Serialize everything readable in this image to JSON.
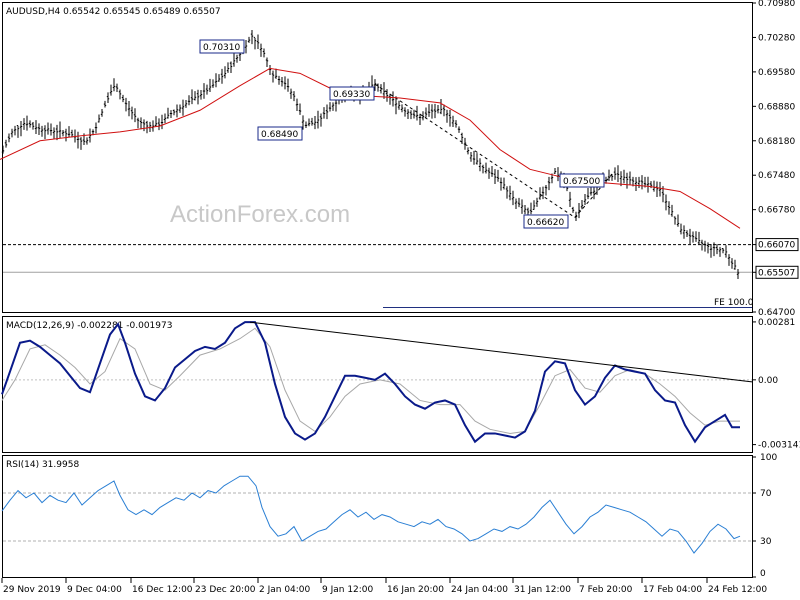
{
  "header": {
    "main": "AUDUSD,H4  0.65542 0.65545 0.65489 0.65507",
    "macd": "MACD(12,26,9) -0.002281 -0.001973",
    "rsi": "RSI(14) 31.9958"
  },
  "watermark": "ActionForex.com",
  "fe_label": "FE 100.0",
  "chart_data": [
    {
      "type": "line",
      "name": "price",
      "ylim": [
        0.647,
        0.7098
      ],
      "price_ticks": [
        "0.70980",
        "0.70280",
        "0.69580",
        "0.68880",
        "0.68180",
        "0.67480",
        "0.66780",
        "0.66070",
        "0.65507",
        "0.64700"
      ],
      "x_labels": [
        "29 Nov 2019",
        "9 Dec 04:00",
        "16 Dec 12:00",
        "23 Dec 20:00",
        "2 Jan 04:00",
        "9 Jan 12:00",
        "16 Jan 20:00",
        "24 Jan 04:00",
        "31 Jan 12:00",
        "7 Feb 20:00",
        "17 Feb 04:00",
        "24 Feb 12:00"
      ],
      "annotations": [
        "0.70310",
        "0.68490",
        "0.69330",
        "0.66620",
        "0.67500"
      ],
      "levels": [
        0.6607,
        0.65507
      ],
      "last_price": "0.65507",
      "close_path": [
        [
          0,
          0.6785
        ],
        [
          12,
          0.6835
        ],
        [
          25,
          0.6855
        ],
        [
          40,
          0.6842
        ],
        [
          55,
          0.6838
        ],
        [
          70,
          0.6832
        ],
        [
          85,
          0.6815
        ],
        [
          95,
          0.6842
        ],
        [
          105,
          0.689
        ],
        [
          115,
          0.6935
        ],
        [
          122,
          0.6905
        ],
        [
          130,
          0.688
        ],
        [
          140,
          0.6855
        ],
        [
          150,
          0.6848
        ],
        [
          160,
          0.6852
        ],
        [
          170,
          0.6872
        ],
        [
          180,
          0.6885
        ],
        [
          195,
          0.6905
        ],
        [
          210,
          0.6925
        ],
        [
          225,
          0.6955
        ],
        [
          240,
          0.6995
        ],
        [
          252,
          0.7031
        ],
        [
          262,
          0.7005
        ],
        [
          272,
          0.6955
        ],
        [
          285,
          0.6935
        ],
        [
          295,
          0.6905
        ],
        [
          305,
          0.6849
        ],
        [
          318,
          0.6858
        ],
        [
          330,
          0.6885
        ],
        [
          345,
          0.6915
        ],
        [
          360,
          0.6912
        ],
        [
          375,
          0.6933
        ],
        [
          390,
          0.6905
        ],
        [
          405,
          0.688
        ],
        [
          420,
          0.6865
        ],
        [
          432,
          0.6878
        ],
        [
          445,
          0.688
        ],
        [
          458,
          0.6845
        ],
        [
          470,
          0.679
        ],
        [
          485,
          0.676
        ],
        [
          500,
          0.6738
        ],
        [
          515,
          0.6695
        ],
        [
          530,
          0.667
        ],
        [
          545,
          0.672
        ],
        [
          555,
          0.6755
        ],
        [
          565,
          0.6735
        ],
        [
          575,
          0.6662
        ],
        [
          585,
          0.6698
        ],
        [
          600,
          0.673
        ],
        [
          615,
          0.675
        ],
        [
          630,
          0.674
        ],
        [
          645,
          0.673
        ],
        [
          660,
          0.672
        ],
        [
          670,
          0.668
        ],
        [
          680,
          0.664
        ],
        [
          695,
          0.6618
        ],
        [
          710,
          0.66
        ],
        [
          725,
          0.6595
        ],
        [
          738,
          0.6551
        ]
      ],
      "ma_path": [
        [
          0,
          0.678
        ],
        [
          40,
          0.6818
        ],
        [
          80,
          0.6828
        ],
        [
          120,
          0.6836
        ],
        [
          160,
          0.6848
        ],
        [
          200,
          0.688
        ],
        [
          240,
          0.693
        ],
        [
          270,
          0.6965
        ],
        [
          300,
          0.6955
        ],
        [
          330,
          0.6925
        ],
        [
          360,
          0.691
        ],
        [
          400,
          0.6905
        ],
        [
          440,
          0.6895
        ],
        [
          470,
          0.686
        ],
        [
          500,
          0.68
        ],
        [
          530,
          0.676
        ],
        [
          560,
          0.6745
        ],
        [
          590,
          0.6735
        ],
        [
          620,
          0.673
        ],
        [
          650,
          0.6725
        ],
        [
          680,
          0.6715
        ],
        [
          710,
          0.668
        ],
        [
          740,
          0.664
        ]
      ]
    },
    {
      "type": "line",
      "name": "MACD(12,26,9)",
      "ylim": [
        -0.0035,
        0.003
      ],
      "ticks": [
        "0.00281",
        "0.00",
        "-0.003141"
      ],
      "macd_path": [
        [
          2,
          -0.0007
        ],
        [
          10,
          0.0004
        ],
        [
          20,
          0.0018
        ],
        [
          30,
          0.0019
        ],
        [
          40,
          0.0016
        ],
        [
          50,
          0.0012
        ],
        [
          60,
          0.0008
        ],
        [
          70,
          0.0002
        ],
        [
          80,
          -0.0004
        ],
        [
          90,
          -0.0006
        ],
        [
          100,
          0.0008
        ],
        [
          110,
          0.0022
        ],
        [
          118,
          0.0027
        ],
        [
          125,
          0.0018
        ],
        [
          135,
          0.0003
        ],
        [
          145,
          -0.0008
        ],
        [
          155,
          -0.001
        ],
        [
          165,
          -0.0004
        ],
        [
          175,
          0.0006
        ],
        [
          185,
          0.001
        ],
        [
          195,
          0.0014
        ],
        [
          205,
          0.0016
        ],
        [
          215,
          0.0015
        ],
        [
          225,
          0.0018
        ],
        [
          235,
          0.0025
        ],
        [
          245,
          0.0028
        ],
        [
          255,
          0.0028
        ],
        [
          265,
          0.0018
        ],
        [
          275,
          -0.0002
        ],
        [
          285,
          -0.0018
        ],
        [
          295,
          -0.0026
        ],
        [
          305,
          -0.0029
        ],
        [
          315,
          -0.0026
        ],
        [
          325,
          -0.0018
        ],
        [
          335,
          -0.0008
        ],
        [
          345,
          0.0002
        ],
        [
          355,
          0.0002
        ],
        [
          365,
          0.0001
        ],
        [
          375,
          0.0
        ],
        [
          385,
          0.0003
        ],
        [
          395,
          -0.0002
        ],
        [
          405,
          -0.0008
        ],
        [
          415,
          -0.0012
        ],
        [
          425,
          -0.0014
        ],
        [
          435,
          -0.0011
        ],
        [
          445,
          -0.001
        ],
        [
          455,
          -0.0012
        ],
        [
          465,
          -0.0022
        ],
        [
          475,
          -0.003
        ],
        [
          485,
          -0.0026
        ],
        [
          495,
          -0.0026
        ],
        [
          505,
          -0.0027
        ],
        [
          515,
          -0.0028
        ],
        [
          525,
          -0.0025
        ],
        [
          535,
          -0.0015
        ],
        [
          545,
          0.0004
        ],
        [
          555,
          0.0009
        ],
        [
          565,
          0.0008
        ],
        [
          575,
          -0.0005
        ],
        [
          585,
          -0.0012
        ],
        [
          595,
          -0.0008
        ],
        [
          605,
          0.0001
        ],
        [
          615,
          0.0007
        ],
        [
          625,
          0.0005
        ],
        [
          635,
          0.0004
        ],
        [
          645,
          0.0003
        ],
        [
          655,
          -0.0005
        ],
        [
          665,
          -0.001
        ],
        [
          675,
          -0.0011
        ],
        [
          685,
          -0.0022
        ],
        [
          695,
          -0.003
        ],
        [
          705,
          -0.0023
        ],
        [
          715,
          -0.002
        ],
        [
          725,
          -0.0017
        ],
        [
          732,
          -0.0023
        ],
        [
          740,
          -0.0023
        ]
      ],
      "signal_path": [
        [
          2,
          -0.001
        ],
        [
          15,
          0.0
        ],
        [
          30,
          0.0015
        ],
        [
          45,
          0.0017
        ],
        [
          60,
          0.0012
        ],
        [
          75,
          0.0006
        ],
        [
          90,
          -0.0002
        ],
        [
          105,
          0.0004
        ],
        [
          120,
          0.002
        ],
        [
          135,
          0.0015
        ],
        [
          150,
          -0.0002
        ],
        [
          165,
          -0.0005
        ],
        [
          180,
          0.0002
        ],
        [
          200,
          0.0012
        ],
        [
          220,
          0.0015
        ],
        [
          240,
          0.002
        ],
        [
          255,
          0.0025
        ],
        [
          270,
          0.0016
        ],
        [
          285,
          -0.0005
        ],
        [
          300,
          -0.002
        ],
        [
          315,
          -0.0025
        ],
        [
          330,
          -0.0018
        ],
        [
          345,
          -0.0008
        ],
        [
          360,
          -0.0002
        ],
        [
          380,
          0.0
        ],
        [
          400,
          -0.0002
        ],
        [
          420,
          -0.001
        ],
        [
          440,
          -0.0012
        ],
        [
          460,
          -0.0012
        ],
        [
          475,
          -0.002
        ],
        [
          490,
          -0.0024
        ],
        [
          510,
          -0.0026
        ],
        [
          525,
          -0.0025
        ],
        [
          540,
          -0.0012
        ],
        [
          555,
          0.0002
        ],
        [
          570,
          0.0005
        ],
        [
          585,
          -0.0004
        ],
        [
          600,
          -0.0006
        ],
        [
          615,
          0.0002
        ],
        [
          630,
          0.0005
        ],
        [
          645,
          0.0003
        ],
        [
          660,
          -0.0002
        ],
        [
          675,
          -0.0008
        ],
        [
          690,
          -0.0016
        ],
        [
          705,
          -0.0022
        ],
        [
          720,
          -0.002
        ],
        [
          740,
          -0.002
        ]
      ],
      "trendline": [
        [
          250,
          0.0028
        ],
        [
          752,
          -0.0001
        ]
      ]
    },
    {
      "type": "line",
      "name": "RSI(14)",
      "ylim": [
        0,
        100
      ],
      "ticks": [
        "100",
        "70",
        "30",
        "0"
      ],
      "levels": [
        70,
        30
      ],
      "rsi_path": [
        [
          2,
          55
        ],
        [
          10,
          64
        ],
        [
          18,
          72
        ],
        [
          26,
          66
        ],
        [
          34,
          70
        ],
        [
          42,
          62
        ],
        [
          50,
          68
        ],
        [
          58,
          64
        ],
        [
          66,
          62
        ],
        [
          74,
          70
        ],
        [
          82,
          60
        ],
        [
          90,
          66
        ],
        [
          98,
          72
        ],
        [
          106,
          76
        ],
        [
          114,
          80
        ],
        [
          120,
          68
        ],
        [
          128,
          56
        ],
        [
          136,
          52
        ],
        [
          144,
          56
        ],
        [
          152,
          52
        ],
        [
          160,
          58
        ],
        [
          168,
          62
        ],
        [
          176,
          66
        ],
        [
          184,
          64
        ],
        [
          192,
          70
        ],
        [
          200,
          66
        ],
        [
          208,
          72
        ],
        [
          216,
          70
        ],
        [
          224,
          76
        ],
        [
          232,
          80
        ],
        [
          240,
          84
        ],
        [
          248,
          84
        ],
        [
          256,
          76
        ],
        [
          262,
          58
        ],
        [
          270,
          42
        ],
        [
          278,
          34
        ],
        [
          286,
          36
        ],
        [
          294,
          42
        ],
        [
          302,
          30
        ],
        [
          310,
          34
        ],
        [
          318,
          38
        ],
        [
          326,
          40
        ],
        [
          334,
          46
        ],
        [
          342,
          52
        ],
        [
          350,
          56
        ],
        [
          358,
          50
        ],
        [
          366,
          54
        ],
        [
          374,
          48
        ],
        [
          382,
          52
        ],
        [
          390,
          50
        ],
        [
          398,
          46
        ],
        [
          406,
          44
        ],
        [
          414,
          42
        ],
        [
          422,
          46
        ],
        [
          430,
          44
        ],
        [
          438,
          48
        ],
        [
          446,
          42
        ],
        [
          454,
          40
        ],
        [
          462,
          36
        ],
        [
          470,
          30
        ],
        [
          478,
          32
        ],
        [
          486,
          36
        ],
        [
          494,
          40
        ],
        [
          502,
          38
        ],
        [
          510,
          42
        ],
        [
          518,
          40
        ],
        [
          526,
          44
        ],
        [
          534,
          50
        ],
        [
          542,
          58
        ],
        [
          550,
          64
        ],
        [
          558,
          54
        ],
        [
          566,
          44
        ],
        [
          574,
          36
        ],
        [
          582,
          42
        ],
        [
          590,
          50
        ],
        [
          598,
          54
        ],
        [
          606,
          60
        ],
        [
          614,
          58
        ],
        [
          622,
          56
        ],
        [
          630,
          54
        ],
        [
          638,
          50
        ],
        [
          646,
          46
        ],
        [
          654,
          40
        ],
        [
          662,
          34
        ],
        [
          670,
          40
        ],
        [
          678,
          38
        ],
        [
          686,
          30
        ],
        [
          694,
          20
        ],
        [
          702,
          28
        ],
        [
          710,
          38
        ],
        [
          718,
          44
        ],
        [
          726,
          40
        ],
        [
          734,
          32
        ],
        [
          740,
          34
        ]
      ]
    }
  ]
}
